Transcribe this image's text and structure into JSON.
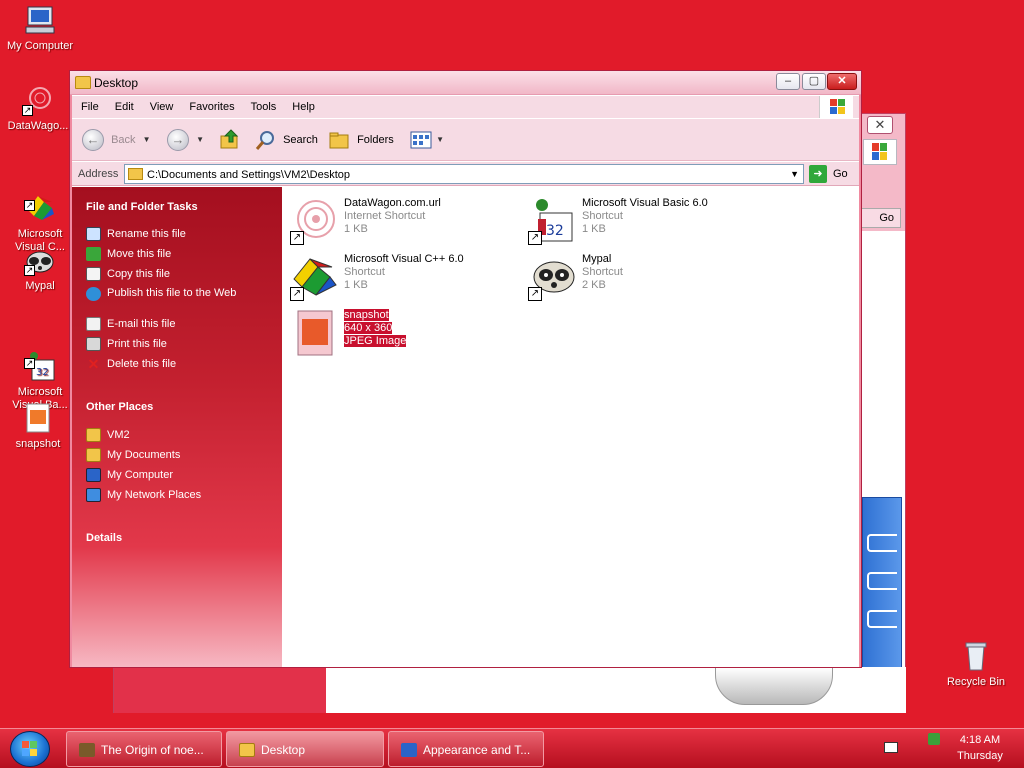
{
  "desktop": {
    "icons": {
      "my_computer": "My Computer",
      "datawagon": "DataWago...",
      "msvc": "Microsoft\nVisual C...",
      "mypal": "Mypal",
      "msvb": "Microsoft\nVisual Ba...",
      "snapshot": "snapshot",
      "recycle": "Recycle Bin"
    }
  },
  "window": {
    "title": "Desktop",
    "menu": [
      "File",
      "Edit",
      "View",
      "Favorites",
      "Tools",
      "Help"
    ],
    "toolbar": {
      "back": "Back",
      "search": "Search",
      "folders": "Folders"
    },
    "address": {
      "label": "Address",
      "path": "C:\\Documents and Settings\\VM2\\Desktop",
      "go": "Go"
    }
  },
  "taskpane": {
    "file_tasks_title": "File and Folder Tasks",
    "file_tasks": [
      "Rename this file",
      "Move this file",
      "Copy this file",
      "Publish this file to the Web",
      "E-mail this file",
      "Print this file",
      "Delete this file"
    ],
    "other_places_title": "Other Places",
    "other_places": [
      "VM2",
      "My Documents",
      "My Computer",
      "My Network Places"
    ],
    "details_title": "Details"
  },
  "files": [
    {
      "name": "DataWagon.com.url",
      "type": "Internet Shortcut",
      "size": "1 KB"
    },
    {
      "name": "Microsoft Visual Basic 6.0",
      "type": "Shortcut",
      "size": "1 KB"
    },
    {
      "name": "Microsoft Visual C++ 6.0",
      "type": "Shortcut",
      "size": "1 KB"
    },
    {
      "name": "Mypal",
      "type": "Shortcut",
      "size": "2 KB"
    },
    {
      "name": "snapshot",
      "type": "640 x 360",
      "size": "JPEG Image"
    }
  ],
  "background_window": {
    "go": "Go"
  },
  "taskbar": {
    "tasks": [
      "The Origin of noe...",
      "Desktop",
      "Appearance and T..."
    ],
    "time": "4:18 AM",
    "day": "Thursday"
  },
  "colors": {
    "desktop_bg": "#e11b2a",
    "selection": "#c8102e",
    "taskpane_top": "#a40f1f"
  }
}
